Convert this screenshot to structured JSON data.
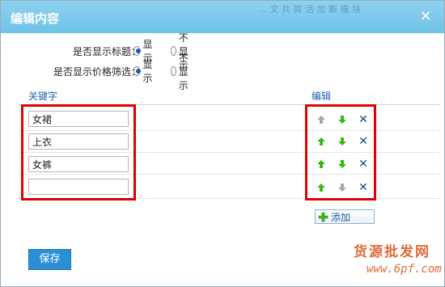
{
  "dialog": {
    "title": "编辑内容",
    "background_ghost_text": "… 文 共 其 活 加 新 模 块",
    "close_glyph": "✕"
  },
  "options": [
    {
      "label": "是否显示标题：",
      "choices": [
        "显示",
        "不显示"
      ],
      "selected": "显示"
    },
    {
      "label": "是否显示价格筛选：",
      "choices": [
        "显示",
        "不显示"
      ],
      "selected": "显示"
    }
  ],
  "table": {
    "headers": {
      "keyword": "关键字",
      "edit": "编辑"
    },
    "rows": [
      {
        "keyword": "女裙",
        "up_enabled": false,
        "down_enabled": true
      },
      {
        "keyword": "上衣",
        "up_enabled": true,
        "down_enabled": true
      },
      {
        "keyword": "女裤",
        "up_enabled": true,
        "down_enabled": true
      },
      {
        "keyword": "",
        "up_enabled": true,
        "down_enabled": false
      }
    ]
  },
  "actions": {
    "add_label": "添加",
    "save_label": "保存"
  },
  "watermark": {
    "line1": "货源批发网",
    "line2": "www.6pf.com"
  },
  "colors": {
    "titlebar": "#7fc9ed",
    "highlight": "#e10000",
    "arrow_enabled": "#3cb81c",
    "arrow_disabled": "#a8a8a8",
    "delete": "#1c4a8a"
  }
}
